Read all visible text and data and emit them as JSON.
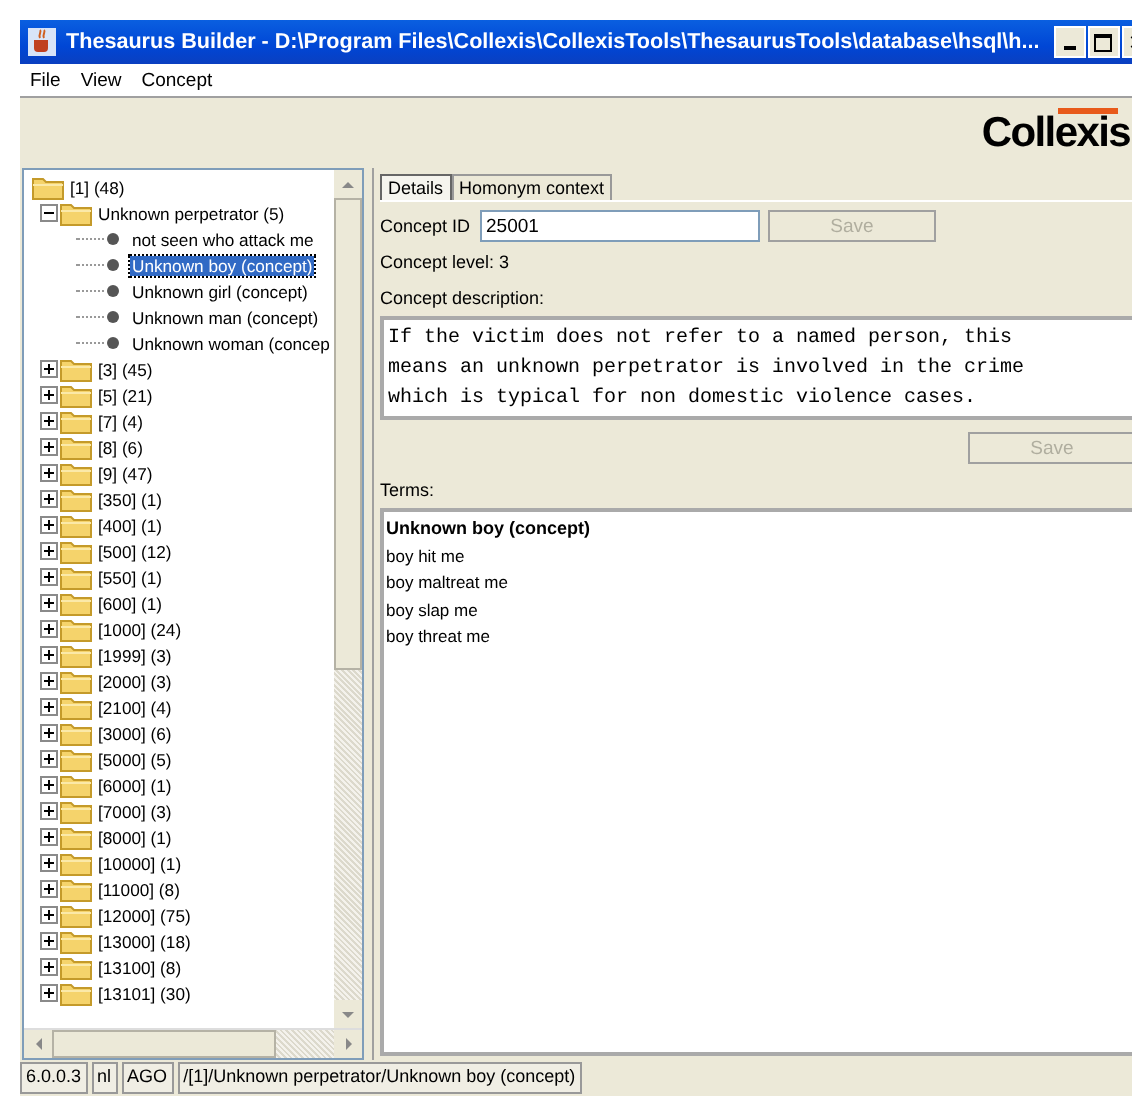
{
  "window": {
    "title": "Thesaurus Builder - D:\\Program Files\\Collexis\\CollexisTools\\ThesaurusTools\\database\\hsql\\h..."
  },
  "menu": [
    "File",
    "View",
    "Concept"
  ],
  "logo": "Collexis",
  "tree": [
    {
      "label": "[1] (48)",
      "selected": false,
      "children": [
        {
          "label": "Unknown perpetrator (5)",
          "expanded": true,
          "selected": false,
          "children": [
            {
              "label": "not seen who attack me",
              "selected": false
            },
            {
              "label": "Unknown boy (concept)",
              "selected": true
            },
            {
              "label": "Unknown girl (concept)",
              "selected": false
            },
            {
              "label": "Unknown man (concept)",
              "selected": false
            },
            {
              "label": "Unknown woman (concep",
              "selected": false
            }
          ]
        },
        {
          "label": "[3] (45)",
          "expanded": false,
          "selected": false
        },
        {
          "label": "[5] (21)",
          "expanded": false,
          "selected": false
        },
        {
          "label": "[7] (4)",
          "expanded": false,
          "selected": false
        },
        {
          "label": "[8] (6)",
          "expanded": false,
          "selected": false
        },
        {
          "label": "[9] (47)",
          "expanded": false,
          "selected": false
        },
        {
          "label": "[350] (1)",
          "expanded": false,
          "selected": false
        },
        {
          "label": "[400] (1)",
          "expanded": false,
          "selected": false
        },
        {
          "label": "[500] (12)",
          "expanded": false,
          "selected": false
        },
        {
          "label": "[550] (1)",
          "expanded": false,
          "selected": false
        },
        {
          "label": "[600] (1)",
          "expanded": false,
          "selected": false
        },
        {
          "label": "[1000] (24)",
          "expanded": false,
          "selected": false
        },
        {
          "label": "[1999] (3)",
          "expanded": false,
          "selected": false
        },
        {
          "label": "[2000] (3)",
          "expanded": false,
          "selected": false
        },
        {
          "label": "[2100] (4)",
          "expanded": false,
          "selected": false
        },
        {
          "label": "[3000] (6)",
          "expanded": false,
          "selected": false
        },
        {
          "label": "[5000] (5)",
          "expanded": false,
          "selected": false
        },
        {
          "label": "[6000] (1)",
          "expanded": false,
          "selected": false
        },
        {
          "label": "[7000] (3)",
          "expanded": false,
          "selected": false
        },
        {
          "label": "[8000] (1)",
          "expanded": false,
          "selected": false
        },
        {
          "label": "[10000] (1)",
          "expanded": false,
          "selected": false
        },
        {
          "label": "[11000] (8)",
          "expanded": false,
          "selected": false
        },
        {
          "label": "[12000] (75)",
          "expanded": false,
          "selected": false
        },
        {
          "label": "[13000] (18)",
          "expanded": false,
          "selected": false
        },
        {
          "label": "[13100] (8)",
          "expanded": false,
          "selected": false
        },
        {
          "label": "[13101] (30)",
          "expanded": false,
          "selected": false
        }
      ]
    }
  ],
  "tabs": [
    {
      "label": "Details",
      "selected": true
    },
    {
      "label": "Homonym context",
      "selected": false
    }
  ],
  "details": {
    "id_label": "Concept ID",
    "id_value": "25001",
    "id_save": {
      "label": "Save",
      "disabled": true
    },
    "level": "Concept level: 3",
    "description_label": "Concept description:",
    "description": "If the victim does not refer to a named person, this means an unknown perpetrator is involved in the crime which is typical for non domestic violence cases.",
    "description_save": {
      "label": "Save",
      "disabled": true
    },
    "terms_label": "Terms:",
    "terms": [
      {
        "text": "Unknown boy (concept)",
        "preferred": true
      },
      {
        "text": "boy hit me",
        "preferred": false
      },
      {
        "text": "boy maltreat me",
        "preferred": false
      },
      {
        "text": "boy slap me",
        "preferred": false
      },
      {
        "text": "boy threat me",
        "preferred": false
      }
    ]
  },
  "status_bar": [
    "6.0.0.3",
    "nl",
    "AGO",
    "/[1]/Unknown perpetrator/Unknown boy (concept)"
  ]
}
